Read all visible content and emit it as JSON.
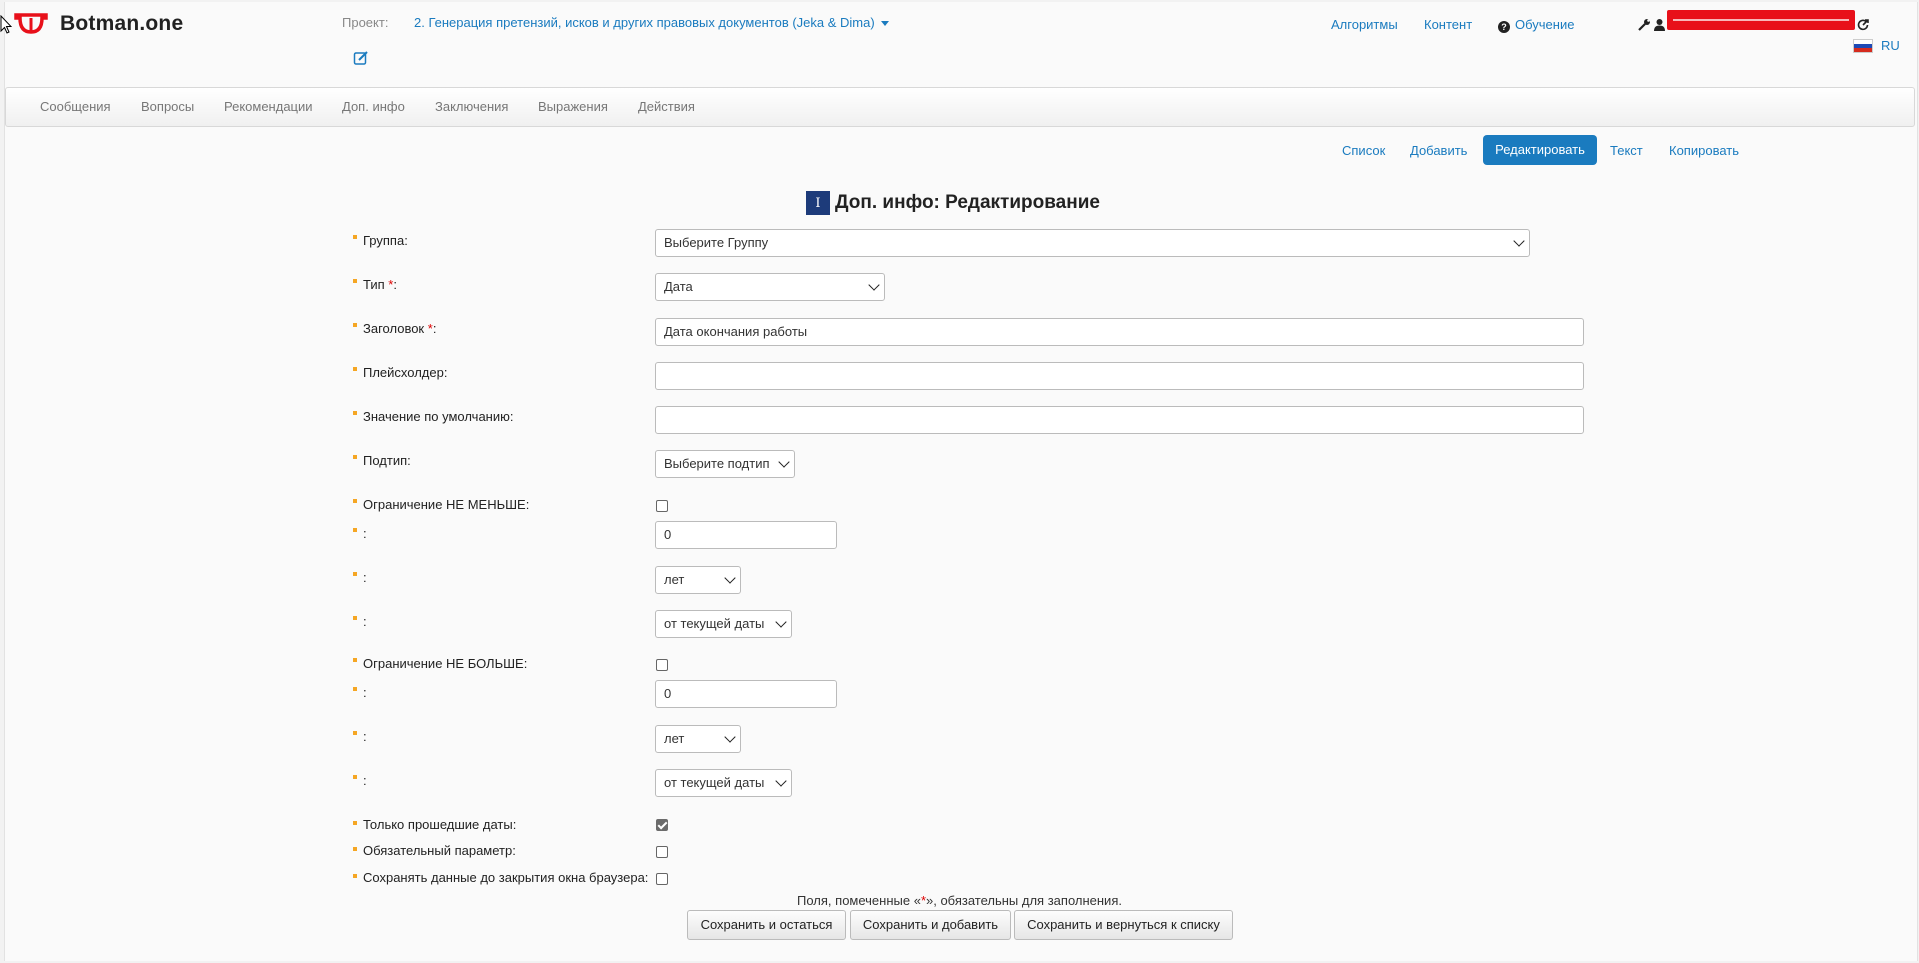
{
  "header": {
    "brand": "Botman.one",
    "project_label": "Проект:",
    "project_name": "2. Генерация претензий, исков и других правовых документов (Jeka & Dima)",
    "links": {
      "algorithms": "Алгоритмы",
      "content": "Контент",
      "training": "Обучение"
    },
    "language": "RU",
    "icons": [
      "logo-icon",
      "edit-icon",
      "wrench-icon",
      "user-icon",
      "logout-icon",
      "flag-ru-icon",
      "help-icon"
    ]
  },
  "nav": [
    "Сообщения",
    "Вопросы",
    "Рекомендации",
    "Доп. инфо",
    "Заключения",
    "Выражения",
    "Действия"
  ],
  "actions": {
    "list": "Список",
    "add": "Добавить",
    "edit": "Редактировать",
    "text": "Текст",
    "copy": "Копировать"
  },
  "page_title": "Доп. инфо: Редактирование",
  "form": {
    "group_label": "Группа:",
    "group_value": "Выберите Группу",
    "type_label": "Тип",
    "type_value": "Дата",
    "title_label": "Заголовок",
    "title_value": "Дата окончания работы",
    "placeholder_label": "Плейсхолдер:",
    "placeholder_value": "",
    "default_label": "Значение по умолчанию:",
    "default_value": "",
    "subtype_label": "Подтип:",
    "subtype_value": "Выберите подтип",
    "min_label": "Ограничение НЕ МЕНЬШЕ:",
    "min_checked": false,
    "min_amount": "0",
    "min_unit": "лет",
    "min_ref": "от текущей даты",
    "max_label": "Ограничение НЕ БОЛЬШЕ:",
    "max_checked": false,
    "max_amount": "0",
    "max_unit": "лет",
    "max_ref": "от текущей даты",
    "colon": ":",
    "required_mark": "*",
    "required_suffix": ":",
    "past_only_label": "Только прошедшие даты:",
    "past_only_checked": true,
    "mandatory_label": "Обязательный параметр:",
    "mandatory_checked": false,
    "persist_label": "Сохранять данные до закрытия окна браузера:",
    "persist_checked": false
  },
  "note": {
    "before": "Поля, помеченные «",
    "star": "*",
    "after": "», обязательны для заполнения."
  },
  "buttons": {
    "save_stay": "Сохранить и остаться",
    "save_add": "Сохранить и добавить",
    "save_return": "Сохранить и вернуться к списку"
  },
  "colors": {
    "accent": "#1a7bbf",
    "bullet": "#f5a623",
    "brand": "#e8101a",
    "redaction": "#e8101a"
  }
}
